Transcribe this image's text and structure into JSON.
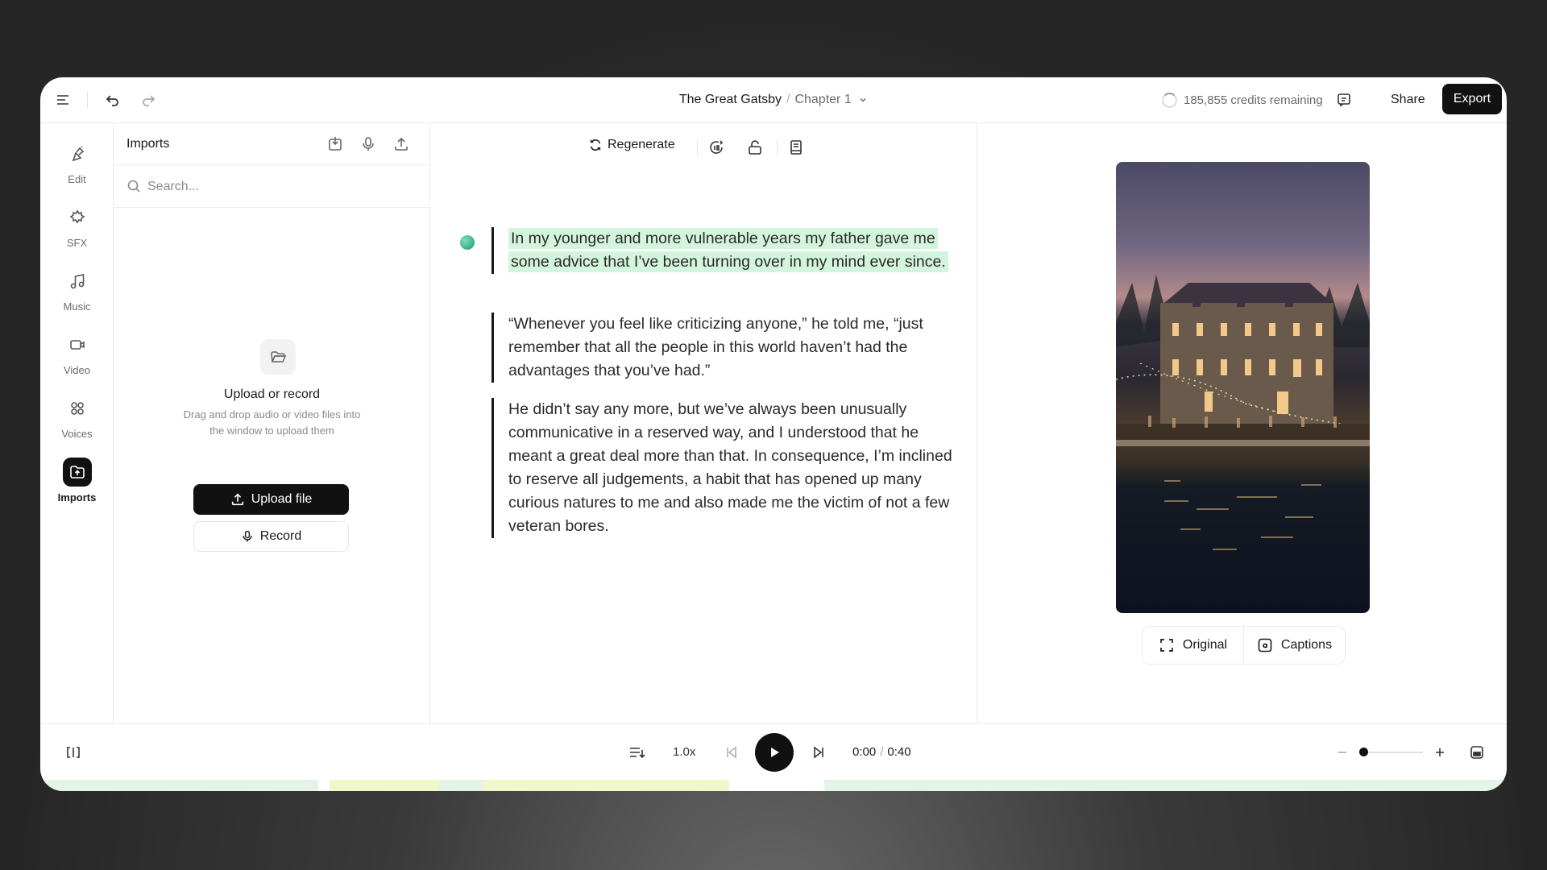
{
  "header": {
    "book_title": "The Great Gatsby",
    "separator": "/",
    "chapter": "Chapter 1",
    "credits": "185,855 credits remaining",
    "share_label": "Share",
    "export_label": "Export"
  },
  "rail": {
    "items": [
      {
        "label": "Edit",
        "icon": "edit-icon"
      },
      {
        "label": "SFX",
        "icon": "sfx-icon"
      },
      {
        "label": "Music",
        "icon": "music-icon"
      },
      {
        "label": "Video",
        "icon": "video-icon"
      },
      {
        "label": "Voices",
        "icon": "voices-icon"
      },
      {
        "label": "Imports",
        "icon": "imports-icon",
        "active": true
      }
    ]
  },
  "imports": {
    "title": "Imports",
    "search_placeholder": "Search...",
    "empty_title": "Upload or record",
    "empty_desc": "Drag and drop audio or video files into the window to upload them",
    "upload_label": "Upload file",
    "record_label": "Record"
  },
  "editor": {
    "regenerate_label": "Regenerate",
    "paragraphs": [
      "In my younger and more vulnerable years my father gave me some advice that I’ve been turning over in my mind ever since.",
      "“Whenever you feel like criticizing anyone,” he told me, “just remember that all the people in this world haven’t had the advantages that you’ve had.”",
      "He didn’t say any more, but we’ve always been unusually communicative in a reserved way, and I understood that he meant a great deal more than that. In consequence, I’m inclined to reserve all judgements, a habit that has opened up many curious natures to me and also made me the victim of not a few veteran bores."
    ],
    "highlight_color": "#d3f5dd"
  },
  "preview": {
    "original_label": "Original",
    "captions_label": "Captions"
  },
  "player": {
    "speed": "1.0x",
    "current_time": "0:00",
    "time_separator": "/",
    "duration": "0:40"
  },
  "colors": {
    "accent": "#111111",
    "highlight": "#d3f5dd"
  }
}
